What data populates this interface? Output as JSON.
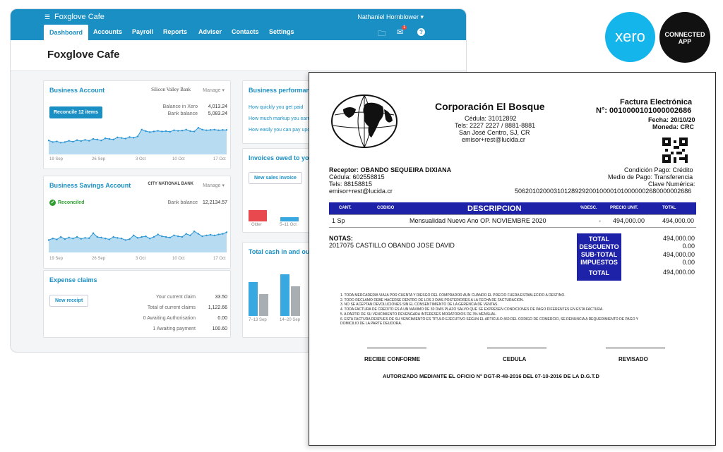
{
  "xero": {
    "org_name": "Foxglove Cafe",
    "user": "Nathaniel Hornblower",
    "nav": [
      "Dashboard",
      "Accounts",
      "Payroll",
      "Reports",
      "Adviser",
      "Contacts",
      "Settings"
    ],
    "notification_count": "1",
    "page_title": "Foxglove Cafe",
    "business_account": {
      "title": "Business Account",
      "bank": "Silicon Valley Bank",
      "manage": "Manage",
      "reconcile_btn": "Reconcile 12 items",
      "balance_xero_label": "Balance in Xero",
      "balance_xero": "4,013.24",
      "bank_balance_label": "Bank balance",
      "bank_balance": "5,083.24",
      "x_labels": [
        "19 Sep",
        "26 Sep",
        "3 Oct",
        "10 Oct",
        "17 Oct"
      ],
      "series": [
        0.45,
        0.4,
        0.42,
        0.38,
        0.4,
        0.44,
        0.41,
        0.46,
        0.43,
        0.47,
        0.44,
        0.5,
        0.48,
        0.45,
        0.52,
        0.5,
        0.48,
        0.55,
        0.53,
        0.51,
        0.56,
        0.54,
        0.58,
        0.8,
        0.75,
        0.72,
        0.74,
        0.76,
        0.74,
        0.75,
        0.73,
        0.78,
        0.76,
        0.77,
        0.8,
        0.75,
        0.74,
        0.86,
        0.8,
        0.78,
        0.79,
        0.8,
        0.78,
        0.79,
        0.79
      ]
    },
    "savings": {
      "title": "Business Savings Account",
      "bank": "CITY NATIONAL BANK",
      "manage": "Manage",
      "reconciled": "Reconciled",
      "bank_balance_label": "Bank balance",
      "bank_balance": "12,2134.57",
      "x_labels": [
        "19 Sep",
        "26 Sep",
        "3 Oct",
        "10 Oct",
        "17 Oct"
      ],
      "series": [
        0.4,
        0.45,
        0.42,
        0.5,
        0.43,
        0.48,
        0.45,
        0.5,
        0.44,
        0.47,
        0.46,
        0.62,
        0.5,
        0.48,
        0.45,
        0.42,
        0.5,
        0.47,
        0.45,
        0.4,
        0.43,
        0.55,
        0.47,
        0.5,
        0.52,
        0.45,
        0.5,
        0.58,
        0.52,
        0.5,
        0.48,
        0.55,
        0.52,
        0.5,
        0.6,
        0.55,
        0.68,
        0.6,
        0.52,
        0.55,
        0.57,
        0.55,
        0.58,
        0.6,
        0.65
      ]
    },
    "performance": {
      "title": "Business performance",
      "links": [
        "How quickly you get paid",
        "How much markup you earn",
        "How easily you can pay upo"
      ]
    },
    "invoices": {
      "title": "Invoices owed to you",
      "new_btn": "New sales invoice",
      "x_labels": [
        "Older",
        "5–11 Oct"
      ]
    },
    "cash": {
      "title": "Total cash in and out",
      "x_labels": [
        "7–13 Sep",
        "14–20 Sep"
      ]
    },
    "expense": {
      "title": "Expense claims",
      "new_btn": "New receipt",
      "rows": [
        {
          "label": "Your current claim",
          "value": "33.50"
        },
        {
          "label": "Total of current claims",
          "value": "1,122.66"
        },
        {
          "label": "0 Awaiting Authorisation",
          "value": "0.00"
        },
        {
          "label": "1 Awaiting payment",
          "value": "100.60"
        }
      ]
    }
  },
  "badges": {
    "xero": "xero",
    "connected": [
      "CONNECTED",
      "APP"
    ]
  },
  "invoice": {
    "company": "Corporación El Bosque",
    "cedula": "Cédula: 31012892",
    "tels": "Tels: 2227 2227 / 8881-8881",
    "address": "San José Centro, SJ, CR",
    "email": "emisor+rest@lucida.cr",
    "doc_type": "Factura Electrónica",
    "number": "N°: 0010000101000002686",
    "date": "Fecha: 20/10/20",
    "currency": "Moneda: CRC",
    "receptor": "Receptor: OBANDO SEQUEIRA DIXIANA",
    "r_cedula": "Cédula: 602558815",
    "r_tels": "Tels: 88158815",
    "r_email": "emisor+rest@lucida.cr",
    "condicion": "Condición Pago: Crédito",
    "medio": "Medio de Pago: Transferencia",
    "clave_label": "Clave Numérica:",
    "clave": "50620102000310128929200100001010000002680000002686",
    "columns": [
      "CANT.",
      "CODIGO",
      "DESCRIPCION",
      "%DESC.",
      "PRECIO UNIT.",
      "TOTAL"
    ],
    "line": {
      "cant": "1 Sp",
      "desc": "Mensualidad Nuevo Ano OP. NOVIEMBRE 2020",
      "disc": "-",
      "unit": "494,000.00",
      "total": "494,000.00"
    },
    "notas_label": "NOTAS:",
    "notas": "2017075 CASTILLO OBANDO JOSE DAVID",
    "totals_labels": [
      "TOTAL",
      "DESCUENTO",
      "SUB-TOTAL",
      "IMPUESTOS",
      "TOTAL"
    ],
    "totals_values": [
      "494,000.00",
      "0.00",
      "494,000.00",
      "0.00",
      "494,000.00"
    ],
    "terms": [
      "1.  TODA MERCADERIA VIAJA POR CUENTA Y RIESGO DEL COMPRADOR AUN CUANDO EL PRECIO FUERA ESTABLECIDO A DESTINO.",
      "2.  TODO RECLAMO DEBE HACERSE DENTRO DE LOS 3 DIAS POSTERIORES A LA FECHA DE FACTURACION.",
      "3.  NO SE ACEPTAN DEVOLUCIONES SIN EL CONSENTIMIENTO DE LA GERENCIA DE VENTAS.",
      "4.  TODA FACTURA DE CREDITO ES A UN MAXIMO DE 30 DIAS PLAZO SALVO QUE SE EXPRESEN CONDICIONES DE PAGO DIFERENTES EN ESTA FACTURA.",
      "5.  A PARTIR DE SU VENCIMIENTO DEVENGARA INTERESES MORATORIOS DE 3% MENSUAL.",
      "6.  ESTA FACTURA DESPUES DE SU VENCIMIENTO ES TITULO EJECUTIVO SEGUN EL ARTICULO 460 DEL CODIGO DE COMERCIO, SE RENUNCIA A REQUERIMIENTO DE PAGO Y",
      "     DOMICILIO DE LA PARTE DEUDORA."
    ],
    "sign": [
      "RECIBE CONFORME",
      "CEDULA",
      "REVISADO"
    ],
    "footer": "AUTORIZADO MEDIANTE EL OFICIO N° DGT-R-48-2016 DEL 07-10-2016 DE LA D.G.T.D"
  }
}
